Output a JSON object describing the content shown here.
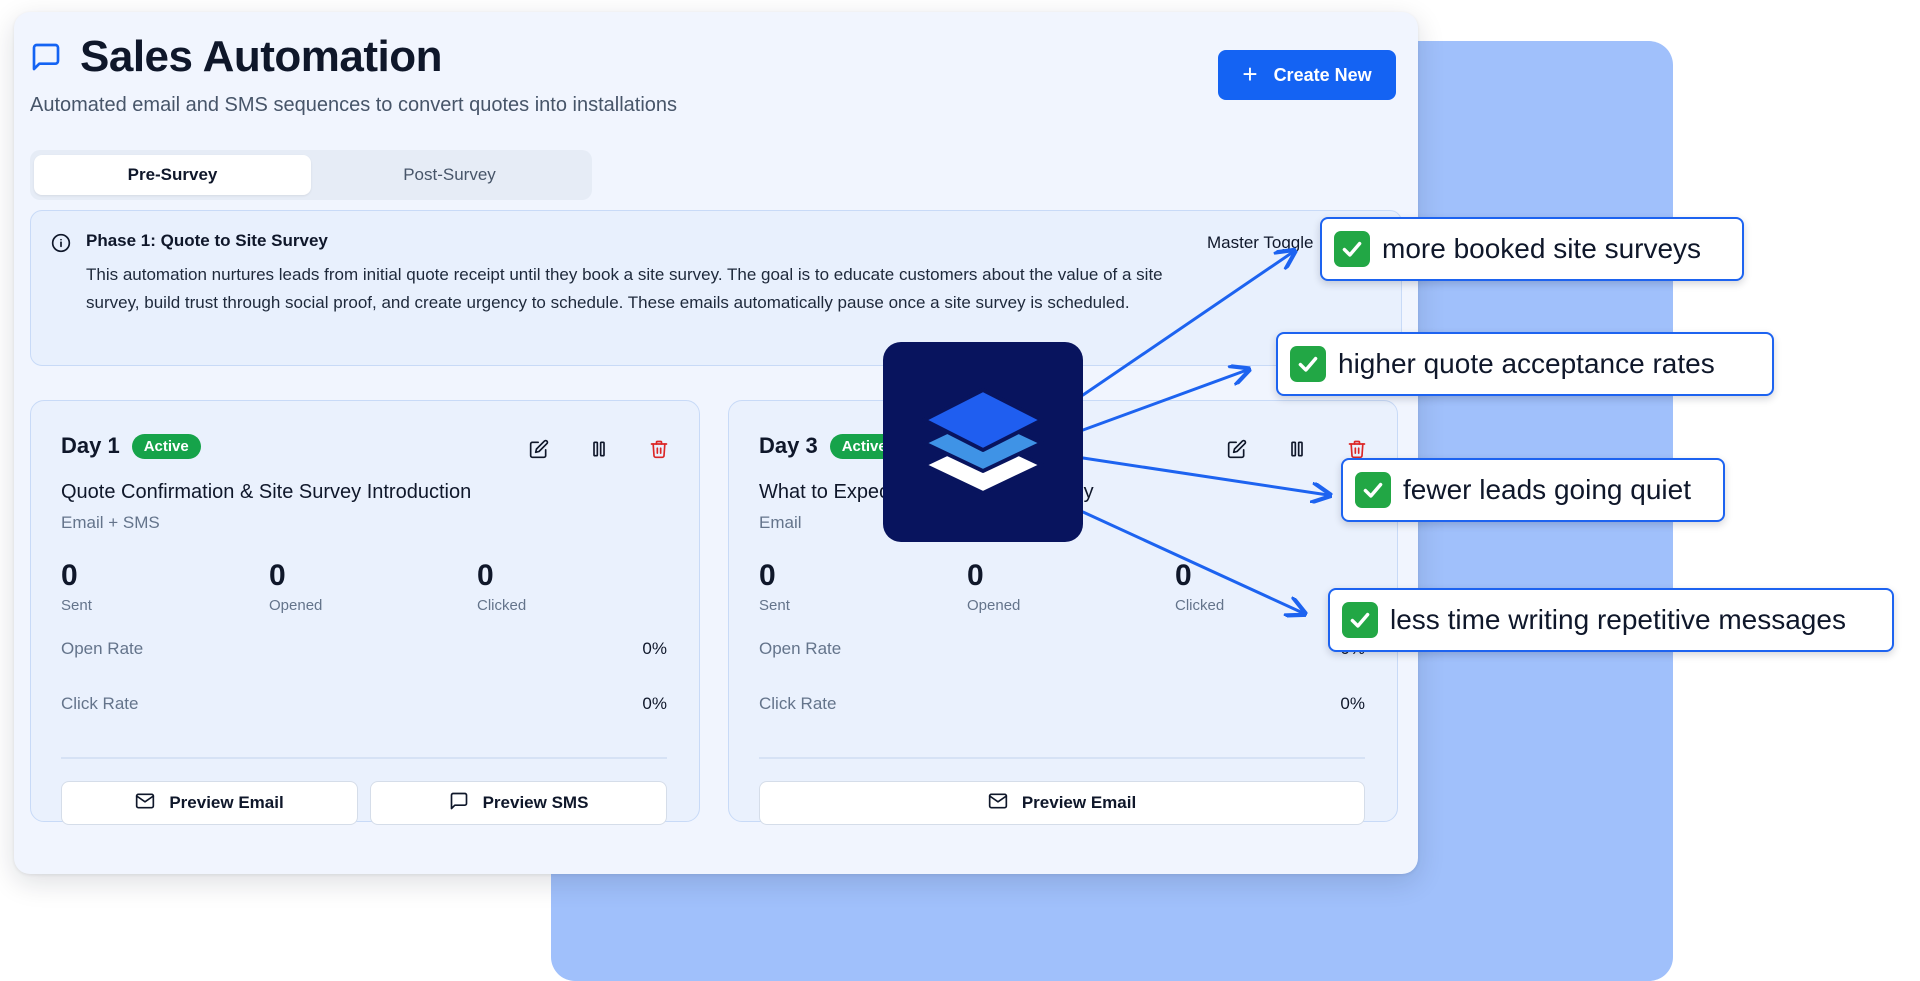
{
  "header": {
    "title": "Sales Automation",
    "subtitle": "Automated email and SMS sequences to convert quotes into installations",
    "create_label": "Create New"
  },
  "tabs": [
    {
      "label": "Pre-Survey",
      "active": true
    },
    {
      "label": "Post-Survey",
      "active": false
    }
  ],
  "phase": {
    "title": "Phase 1: Quote to Site Survey",
    "description": "This automation nurtures leads from initial quote receipt until they book a site survey. The goal is to educate customers about the value of a site survey, build trust through social proof, and create urgency to schedule. These emails automatically pause once a site survey is scheduled.",
    "master_toggle_label": "Master Toggle"
  },
  "cards": [
    {
      "day": "Day 1",
      "status": "Active",
      "title": "Quote Confirmation & Site Survey Introduction",
      "channel": "Email + SMS",
      "stats": [
        {
          "value": "0",
          "label": "Sent"
        },
        {
          "value": "0",
          "label": "Opened"
        },
        {
          "value": "0",
          "label": "Clicked"
        }
      ],
      "open_rate_label": "Open Rate",
      "open_rate": "0%",
      "click_rate_label": "Click Rate",
      "click_rate": "0%",
      "buttons": [
        "Preview Email",
        "Preview SMS"
      ]
    },
    {
      "day": "Day 3",
      "status": "Active",
      "title": "What to Expect from Your Site Survey",
      "channel": "Email",
      "stats": [
        {
          "value": "0",
          "label": "Sent"
        },
        {
          "value": "0",
          "label": "Opened"
        },
        {
          "value": "0",
          "label": "Clicked"
        }
      ],
      "open_rate_label": "Open Rate",
      "open_rate": "0%",
      "click_rate_label": "Click Rate",
      "click_rate": "0%",
      "buttons": [
        "Preview Email"
      ]
    }
  ],
  "callouts": [
    "more booked site surveys",
    "higher quote acceptance rates",
    "fewer leads going quiet",
    "less time writing repetitive messages"
  ],
  "colors": {
    "primary": "#1463f3",
    "active_badge": "#16a34a",
    "delete": "#dc2626",
    "logo_bg": "#08145e",
    "backdrop": "#a0c0fb"
  },
  "icons": {
    "title": "message-square-icon",
    "create": "plus-icon",
    "phase": "info-icon",
    "edit": "edit-icon",
    "pause": "pause-icon",
    "delete": "trash-icon",
    "preview_email": "mail-icon",
    "preview_sms": "message-square-icon",
    "logo": "layers-icon",
    "callout": "check-box-icon"
  }
}
